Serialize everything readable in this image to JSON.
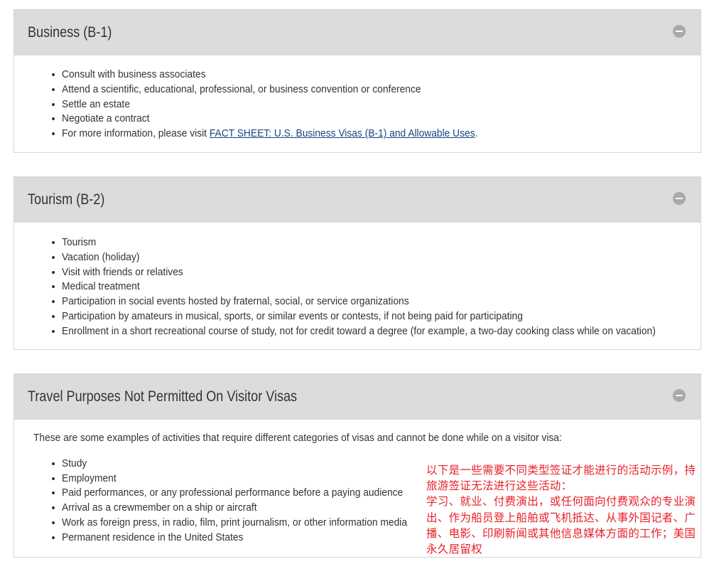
{
  "sections": [
    {
      "title": "Business (B-1)",
      "items": [
        "Consult with business associates",
        "Attend a scientific, educational, professional, or business convention or conference",
        "Settle an estate",
        "Negotiate a contract"
      ],
      "info_prefix": "For more information, please visit ",
      "info_link": "FACT SHEET: U.S. Business Visas (B-1) and Allowable Uses",
      "info_suffix": "."
    },
    {
      "title": "Tourism (B-2)",
      "items": [
        "Tourism",
        "Vacation (holiday)",
        "Visit with friends or relatives",
        "Medical treatment",
        "Participation in social events hosted by fraternal, social, or service organizations",
        "Participation by amateurs in musical, sports, or similar events or contests, if not being paid for participating",
        "Enrollment in a short recreational course of study, not for credit toward a degree (for example, a two-day cooking class while on vacation)"
      ]
    },
    {
      "title": "Travel Purposes Not Permitted On Visitor Visas",
      "intro": "These are some examples of activities that require different categories of visas and cannot be done while on a visitor visa:",
      "items": [
        "Study",
        "Employment",
        "Paid performances, or any professional performance before a paying audience",
        "Arrival as a crewmember on a ship or aircraft",
        "Work as foreign press, in radio, film, print journalism, or other information media",
        "Permanent residence in the United States"
      ]
    }
  ],
  "annotation": {
    "line1": "以下是一些需要不同类型签证才能进行的活动示例，持旅游签证无法进行这些活动：",
    "line2": "学习、就业、付费演出，或任何面向付费观众的专业演出、作为船员登上船舶或飞机抵达、从事外国记者、广播、电影、印刷新闻或其他信息媒体方面的工作；美国永久居留权"
  },
  "colors": {
    "header_bg": "#dcdcdc",
    "link": "#1a4480",
    "annotation": "#e8202a"
  },
  "icons": [
    "collapse-minus-icon"
  ]
}
